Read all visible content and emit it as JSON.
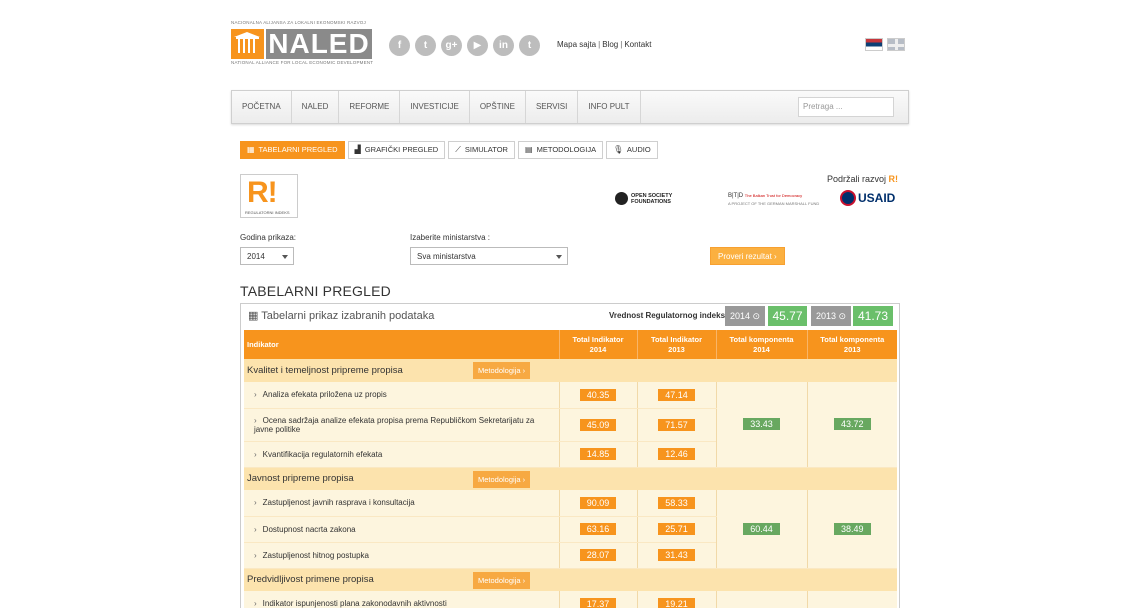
{
  "header": {
    "logo_top_tag": "NACIONALNA ALIJANSA ZA LOKALNI EKONOMSKI RAZVOJ",
    "logo_word": "NALED",
    "logo_bottom_tag": "NATIONAL ALLIANCE FOR LOCAL ECONOMIC DEVELOPMENT",
    "socials": [
      {
        "icon": "facebook-icon",
        "glyph": "f"
      },
      {
        "icon": "twitter-icon",
        "glyph": "t"
      },
      {
        "icon": "google-plus-icon",
        "glyph": "g+"
      },
      {
        "icon": "youtube-icon",
        "glyph": "▶"
      },
      {
        "icon": "linkedin-icon",
        "glyph": "in"
      },
      {
        "icon": "twitter-alt-icon",
        "glyph": "t"
      }
    ],
    "links": [
      "Mapa sajta",
      "Blog",
      "Kontakt"
    ],
    "link_separator": "|"
  },
  "nav": {
    "items": [
      "Početna",
      "NALED",
      "Reforme",
      "Investicije",
      "Opštine",
      "Servisi",
      "Info pult"
    ],
    "search_placeholder": "Pretraga ..."
  },
  "tabs": [
    {
      "label": "Tabelarni pregled",
      "icon": "table-icon",
      "glyph": "▦",
      "active": true
    },
    {
      "label": "Grafički pregled",
      "icon": "chart-icon",
      "glyph": "▟",
      "active": false
    },
    {
      "label": "Simulator",
      "icon": "line-chart-icon",
      "glyph": "⟋",
      "active": false
    },
    {
      "label": "Metodologija",
      "icon": "list-icon",
      "glyph": "▤",
      "active": false
    },
    {
      "label": "Audio",
      "icon": "microphone-icon",
      "glyph": "🎙",
      "active": false
    }
  ],
  "brand": {
    "ri_letters": "R!",
    "ri_sub": "REGULATORNI INDEKS",
    "sponsor_label": "Podržali razvoj",
    "sponsor_mark": "R!",
    "osf_line1": "OPEN SOCIETY",
    "osf_line2": "FOUNDATIONS",
    "btd_main": "B|T|D",
    "btd_side": "The Balkan Trust for Democracy",
    "btd_sub": "A PROJECT OF THE GERMAN MARSHALL FUND",
    "usaid": "USAID"
  },
  "filters": {
    "year_label": "Godina prikaza:",
    "year_value": "2014",
    "ministry_label": "Izaberite ministarstva :",
    "ministry_value": "Sva ministarstva",
    "check_button": "Proveri rezultat ›"
  },
  "overview": {
    "title": "TABELARNI PREGLED",
    "panel_title": "Tabelarni prikaz izabranih podataka",
    "index_label": "Vrednost Regulatornog indeksa:",
    "index": [
      {
        "year": "2014 ⊙",
        "value": "45.77"
      },
      {
        "year": "2013 ⊙",
        "value": "41.73"
      }
    ]
  },
  "table": {
    "headers": {
      "indicator": "Indikator",
      "ti2014_a": "Total Indikator",
      "ti2014_b": "2014",
      "ti2013_a": "Total Indikator",
      "ti2013_b": "2013",
      "tk2014_a": "Total komponenta",
      "tk2014_b": "2014",
      "tk2013_a": "Total komponenta",
      "tk2013_b": "2013"
    },
    "method_button": "Metodologija ›",
    "groups": [
      {
        "name": "Kvalitet i temeljnost pripreme propisa",
        "comp2014": "33.43",
        "comp2013": "43.72",
        "rows": [
          {
            "label": "Analiza efekata priložena uz propis",
            "v2014": "40.35",
            "v2013": "47.14"
          },
          {
            "label": "Ocena sadržaja analize efekata propisa prema Republičkom Sekretarijatu za javne politike",
            "v2014": "45.09",
            "v2013": "71.57"
          },
          {
            "label": "Kvantifikacija regulatornih efekata",
            "v2014": "14.85",
            "v2013": "12.46"
          }
        ]
      },
      {
        "name": "Javnost pripreme propisa",
        "comp2014": "60.44",
        "comp2013": "38.49",
        "rows": [
          {
            "label": "Zastupljenost javnih rasprava i konsultacija",
            "v2014": "90.09",
            "v2013": "58.33"
          },
          {
            "label": "Dostupnost nacrta zakona",
            "v2014": "63.16",
            "v2013": "25.71"
          },
          {
            "label": "Zastupljenost hitnog postupka",
            "v2014": "28.07",
            "v2013": "31.43"
          }
        ]
      },
      {
        "name": "Predvidljivost primene propisa",
        "comp2014": "",
        "comp2013": "",
        "rows": [
          {
            "label": "Indikator ispunjenosti plana zakonodavnih aktivnosti",
            "v2014": "17.37",
            "v2013": "19.21"
          }
        ]
      }
    ]
  },
  "colors": {
    "accent": "#f7941d",
    "group_bg": "#fce3ad",
    "row_bg": "#fdf5de",
    "component_green": "#68a860"
  }
}
